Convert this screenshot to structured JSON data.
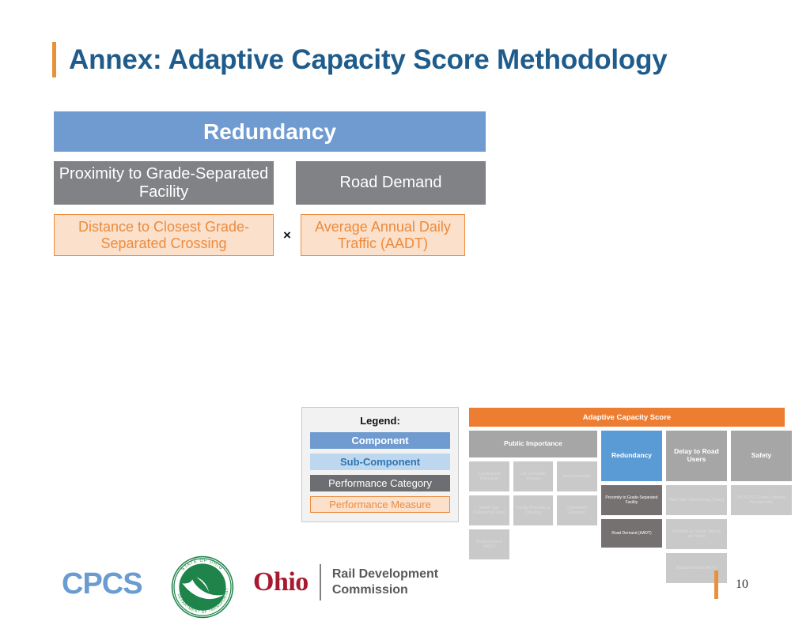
{
  "slide": {
    "title": "Annex: Adaptive Capacity Score Methodology",
    "page_number": "10",
    "accent_color": "#e8913c",
    "title_color": "#1f5c8b"
  },
  "hierarchy": {
    "component": {
      "label": "Redundancy",
      "color": "#6f9bd1"
    },
    "performance_categories": [
      {
        "label": "Proximity to Grade-Separated Facility",
        "color": "#808285"
      },
      {
        "label": "Road Demand",
        "color": "#808285"
      }
    ],
    "operator": "×",
    "performance_measures": [
      {
        "label": "Distance to Closest Grade-Separated Crossing",
        "fill": "#fbe0cc",
        "border": "#ed8b3c",
        "text": "#ed8b3c"
      },
      {
        "label": "Average Annual Daily Traffic (AADT)",
        "fill": "#fbe0cc",
        "border": "#ed8b3c",
        "text": "#ed8b3c"
      }
    ]
  },
  "legend": {
    "title": "Legend:",
    "items": [
      {
        "label": "Component",
        "color": "#6f9bd1"
      },
      {
        "label": "Sub-Component",
        "color": "#bdd7ee"
      },
      {
        "label": "Performance Category",
        "color": "#6d6e71"
      },
      {
        "label": "Performance Measure",
        "color": "#fbe0cc"
      }
    ]
  },
  "thumbnail": {
    "header": {
      "label": "Adaptive Capacity Score",
      "color": "#ed7d31"
    },
    "columns": [
      {
        "heading": "Public Importance",
        "highlighted": false,
        "cells": [
          "Jurisdictional Relevance",
          "Job (Jobs/Site Access)",
          "Key Commodity",
          "Road Type (Functional Class)",
          "Facility Proximity to Crossing",
          "Community Evidence",
          "Road Demand (AADT)"
        ]
      },
      {
        "heading": "Redundancy",
        "highlighted": true,
        "cells": [
          "Proximity to Grade-Separated Facility",
          "Road Demand (AADT)"
        ]
      },
      {
        "heading": "Delay to Road Users",
        "highlighted": false,
        "cells": [
          "Rail Traffic Volume (Avg Trains)",
          "Proximity to Transit, Sidings and Yards",
          "Road Demand (AADT)"
        ]
      },
      {
        "heading": "Safety",
        "highlighted": false,
        "cells": [
          "RIC/ODOT Grade Crossing Hazard Index"
        ]
      }
    ]
  },
  "footer": {
    "logos": {
      "cpcs": "CPCS",
      "odot_outer_top": "STATE OF OHIO",
      "odot_outer_bottom": "DEPARTMENT OF TRANSPORTATION",
      "ordc_ohio": "Ohio",
      "ordc_line1": "Rail Development",
      "ordc_line2": "Commission"
    }
  }
}
